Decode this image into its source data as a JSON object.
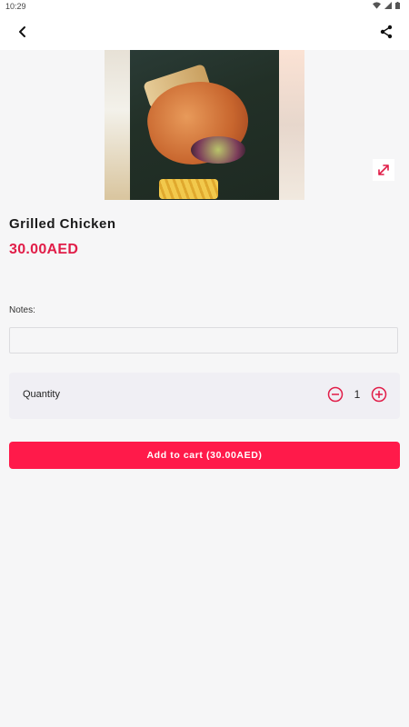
{
  "status": {
    "time": "10:29"
  },
  "toolbar": {
    "back_icon": "chevron-left-icon",
    "share_icon": "share-icon"
  },
  "hero": {
    "image_desc_icon": "food-photo",
    "expand_icon": "expand-arrows-icon",
    "accent_color": "#e11d48"
  },
  "product": {
    "name": "Grilled Chicken",
    "price": "30.00AED"
  },
  "notes": {
    "label": "Notes:",
    "value": "",
    "placeholder": ""
  },
  "quantity": {
    "label": "Quantity",
    "value": "1",
    "minus_icon": "minus-circle-icon",
    "plus_icon": "plus-circle-icon"
  },
  "cart": {
    "button_label": "Add to cart (30.00AED)",
    "button_color": "#ff1a4a"
  }
}
